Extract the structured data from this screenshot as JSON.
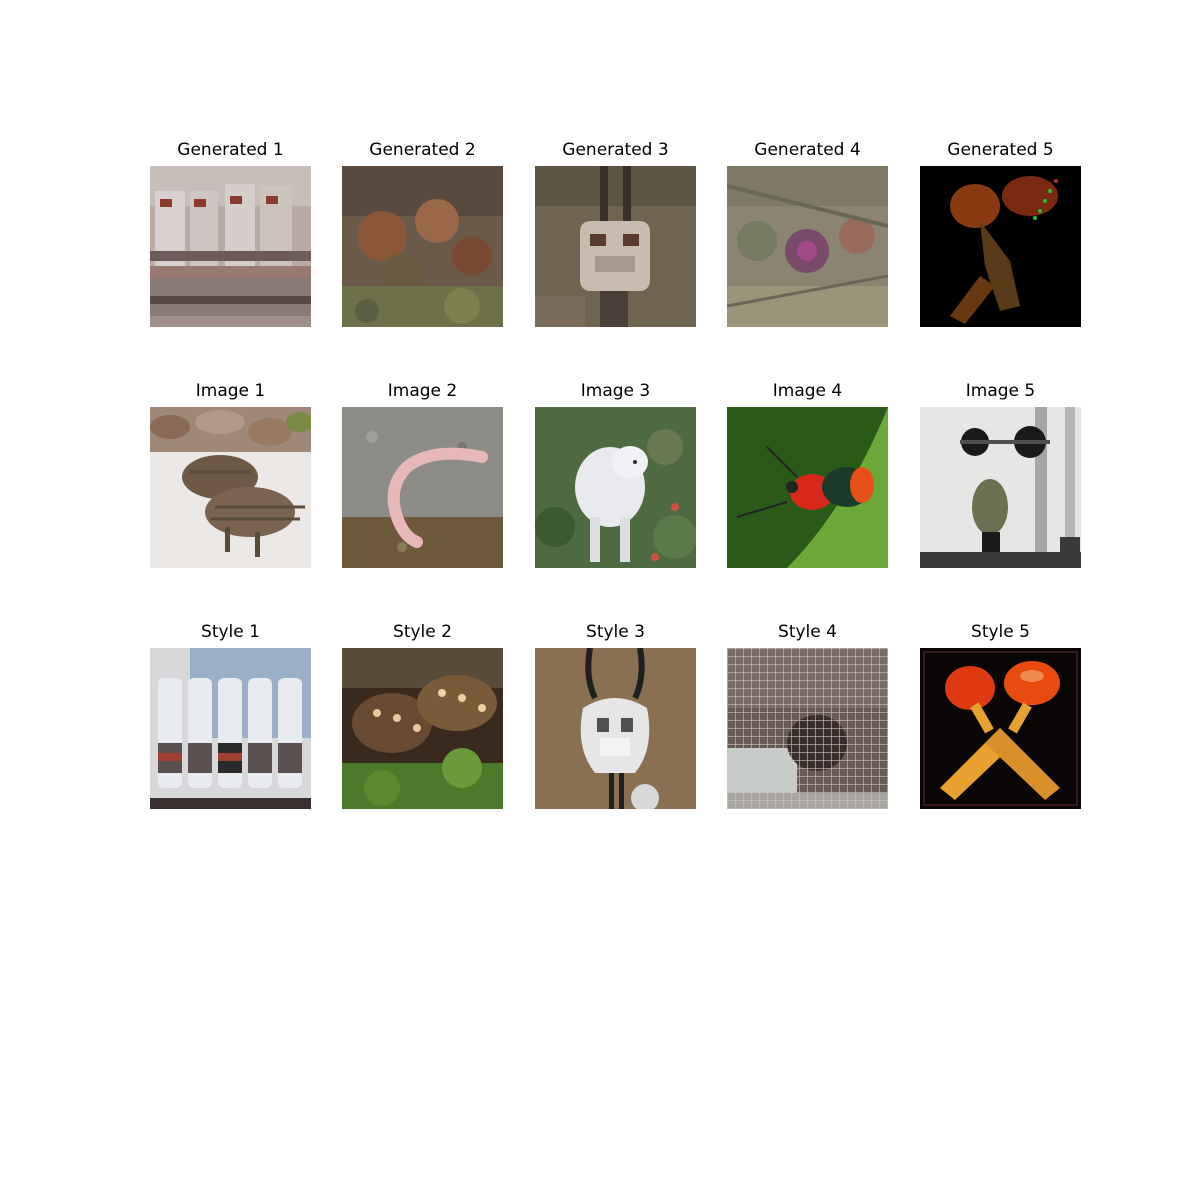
{
  "figure": {
    "rows": [
      {
        "name": "generated",
        "panels": [
          {
            "title": "Generated 1",
            "subject": "stylized storefront with bottles"
          },
          {
            "title": "Generated 2",
            "subject": "stylized textured creatures"
          },
          {
            "title": "Generated 3",
            "subject": "stylized pendant on brown"
          },
          {
            "title": "Generated 4",
            "subject": "stylized mesh with purple blob"
          },
          {
            "title": "Generated 5",
            "subject": "dark stylized orange shape"
          }
        ]
      },
      {
        "name": "image",
        "panels": [
          {
            "title": "Image 1",
            "subject": "striped piglets on snow"
          },
          {
            "title": "Image 2",
            "subject": "pink worm on gravel"
          },
          {
            "title": "Image 3",
            "subject": "white wolf in foliage"
          },
          {
            "title": "Image 4",
            "subject": "red and black beetle on leaf"
          },
          {
            "title": "Image 5",
            "subject": "person lifting barbell in gym"
          }
        ]
      },
      {
        "name": "style",
        "panels": [
          {
            "title": "Style 1",
            "subject": "row of glass bottles"
          },
          {
            "title": "Style 2",
            "subject": "spiky hedgehog-like creatures"
          },
          {
            "title": "Style 3",
            "subject": "bolo tie pendant"
          },
          {
            "title": "Style 4",
            "subject": "wire mesh cage"
          },
          {
            "title": "Style 5",
            "subject": "red and yellow maracas"
          }
        ]
      }
    ]
  }
}
